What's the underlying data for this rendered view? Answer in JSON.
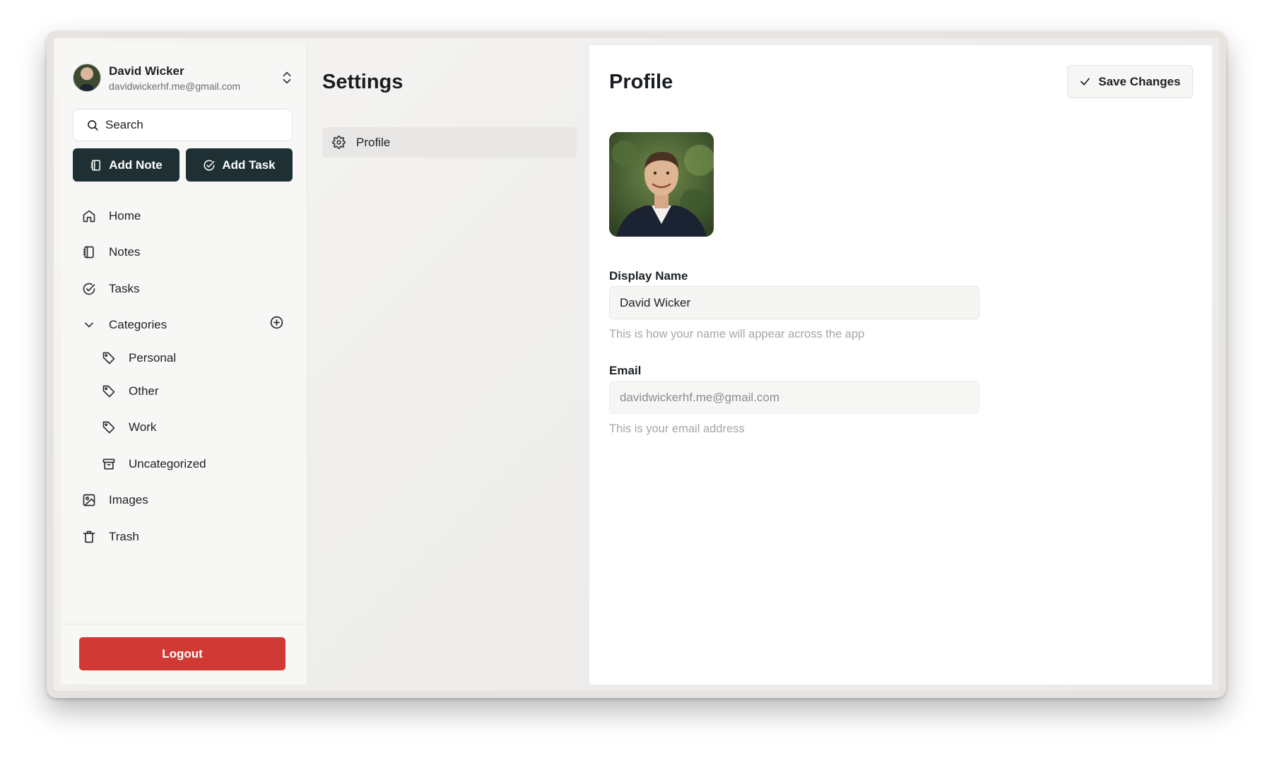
{
  "user": {
    "name": "David Wicker",
    "email": "davidwickerhf.me@gmail.com"
  },
  "search": {
    "label": "Search"
  },
  "actions": {
    "add_note": "Add Note",
    "add_task": "Add Task"
  },
  "nav": {
    "home": "Home",
    "notes": "Notes",
    "tasks": "Tasks",
    "categories": "Categories",
    "categories_items": [
      "Personal",
      "Other",
      "Work",
      "Uncategorized"
    ],
    "images": "Images",
    "trash": "Trash"
  },
  "logout": "Logout",
  "settings": {
    "title": "Settings",
    "items": [
      "Profile"
    ]
  },
  "profile": {
    "title": "Profile",
    "save_label": "Save Changes",
    "display_name_label": "Display Name",
    "display_name_value": "David Wicker",
    "display_name_help": "This is how your name will appear across the app",
    "email_label": "Email",
    "email_value": "davidwickerhf.me@gmail.com",
    "email_help": "This is your email address"
  },
  "colors": {
    "dark_button": "#1f3035",
    "logout": "#d13a34",
    "panel": "#ffffff"
  }
}
